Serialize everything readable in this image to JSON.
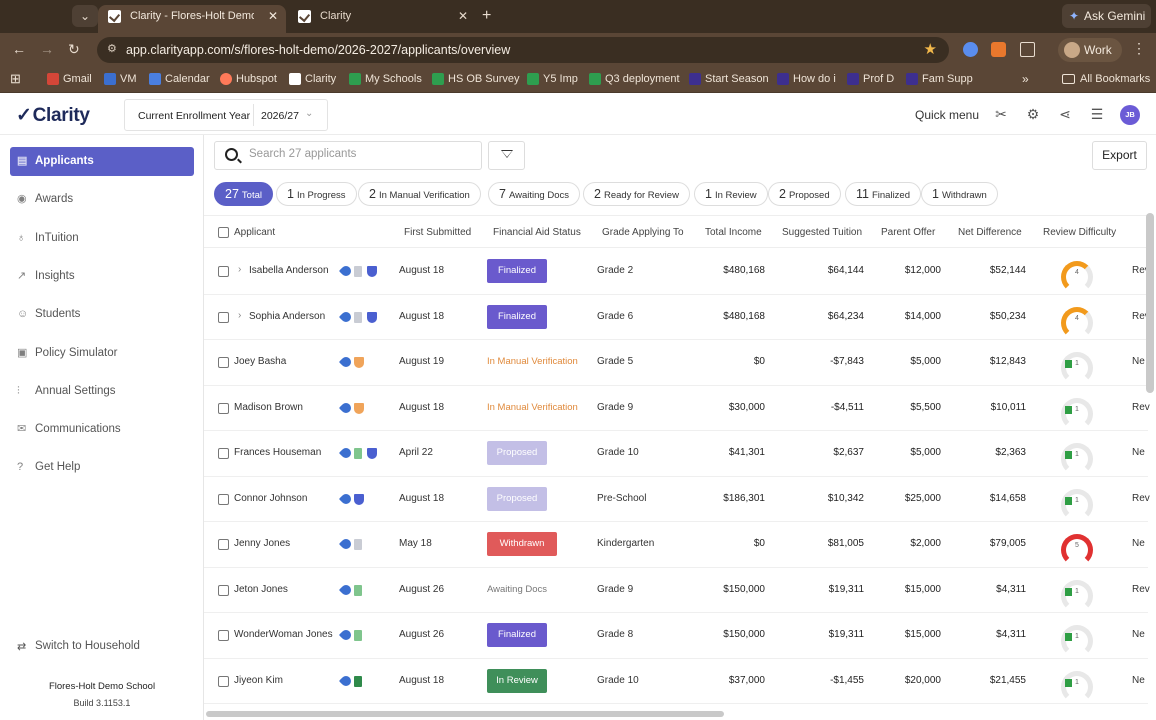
{
  "browser": {
    "tabs": [
      {
        "title": "Clarity - Flores-Holt Demo School",
        "active": true
      },
      {
        "title": "Clarity",
        "active": false
      }
    ],
    "url": "app.clarityapp.com/s/flores-holt-demo/2026-2027/applicants/overview",
    "gemini_label": "Ask Gemini",
    "profile_label": "Work",
    "bookmarks": [
      "Gmail",
      "VM",
      "Calendar",
      "Hubspot",
      "Clarity",
      "My Schools",
      "HS OB Survey",
      "Y5 Imp",
      "Q3 deployment",
      "Start Season",
      "How do i",
      "Prof D",
      "Fam Supp"
    ],
    "all_bookmarks": "All Bookmarks"
  },
  "header": {
    "logo": "Clarity",
    "enroll_label": "Current Enrollment Year",
    "enroll_value": "2026/27",
    "quick_menu": "Quick menu",
    "avatar": "JB"
  },
  "sidebar": {
    "items": [
      {
        "label": "Applicants",
        "icon": "document-icon",
        "active": true
      },
      {
        "label": "Awards",
        "icon": "check-circle-icon",
        "active": false
      },
      {
        "label": "InTuition",
        "icon": "lightbulb-icon",
        "active": false
      },
      {
        "label": "Insights",
        "icon": "trend-icon",
        "active": false
      },
      {
        "label": "Students",
        "icon": "people-icon",
        "active": false
      },
      {
        "label": "Policy Simulator",
        "icon": "policy-icon",
        "active": false
      },
      {
        "label": "Annual Settings",
        "icon": "sliders-icon",
        "active": false
      },
      {
        "label": "Communications",
        "icon": "mail-icon",
        "active": false
      },
      {
        "label": "Get Help",
        "icon": "help-icon",
        "active": false
      }
    ],
    "switch_household": "Switch to Household",
    "school": "Flores-Holt Demo School",
    "build": "Build 3.1153.1"
  },
  "main": {
    "search_placeholder": "Search 27 applicants",
    "export": "Export",
    "chips": [
      {
        "count": "27",
        "label": "Total",
        "active": true
      },
      {
        "count": "1",
        "label": "In Progress",
        "active": false
      },
      {
        "count": "2",
        "label": "In Manual Verification",
        "active": false
      },
      {
        "count": "7",
        "label": "Awaiting Docs",
        "active": false
      },
      {
        "count": "2",
        "label": "Ready for Review",
        "active": false
      },
      {
        "count": "1",
        "label": "In Review",
        "active": false
      },
      {
        "count": "2",
        "label": "Proposed",
        "active": false
      },
      {
        "count": "11",
        "label": "Finalized",
        "active": false
      },
      {
        "count": "1",
        "label": "Withdrawn",
        "active": false
      }
    ],
    "columns": [
      "Applicant",
      "First Submitted",
      "Financial Aid Status",
      "Grade Applying To",
      "Total Income",
      "Suggested Tuition",
      "Parent Offer",
      "Net Difference",
      "Review Difficulty"
    ],
    "rows": [
      {
        "name": "Isabella Anderson",
        "expandable": true,
        "submitted": "August 18",
        "status": "Finalized",
        "status_style": "pill-purple",
        "grade": "Grade 2",
        "income": "$480,168",
        "tuition": "$64,144",
        "offer": "$12,000",
        "net": "$52,144",
        "difficulty": "4",
        "diff_color": "#f29a1c",
        "trail": "Rev",
        "icons": [
          "tag",
          "doc-gray",
          "shield-blue"
        ]
      },
      {
        "name": "Sophia Anderson",
        "expandable": true,
        "submitted": "August 18",
        "status": "Finalized",
        "status_style": "pill-purple",
        "grade": "Grade 6",
        "income": "$480,168",
        "tuition": "$64,234",
        "offer": "$14,000",
        "net": "$50,234",
        "difficulty": "4",
        "diff_color": "#f29a1c",
        "trail": "Rev",
        "icons": [
          "tag",
          "doc-gray",
          "shield-blue"
        ]
      },
      {
        "name": "Joey Basha",
        "expandable": false,
        "submitted": "August 19",
        "status": "In Manual Verification",
        "status_style": "text-orange",
        "grade": "Grade 5",
        "income": "$0",
        "tuition": "-$7,843",
        "offer": "$5,000",
        "net": "$12,843",
        "difficulty": "1",
        "diff_color": "#2f9e44",
        "trail": "Ne",
        "icons": [
          "tag",
          "shield-orange"
        ]
      },
      {
        "name": "Madison Brown",
        "expandable": false,
        "submitted": "August 18",
        "status": "In Manual Verification",
        "status_style": "text-orange",
        "grade": "Grade 9",
        "income": "$30,000",
        "tuition": "-$4,511",
        "offer": "$5,500",
        "net": "$10,011",
        "difficulty": "1",
        "diff_color": "#2f9e44",
        "trail": "Rev",
        "icons": [
          "tag",
          "shield-orange"
        ]
      },
      {
        "name": "Frances Houseman",
        "expandable": false,
        "submitted": "April 22",
        "status": "Proposed",
        "status_style": "pill-lilac",
        "grade": "Grade 10",
        "income": "$41,301",
        "tuition": "$2,637",
        "offer": "$5,000",
        "net": "$2,363",
        "difficulty": "1",
        "diff_color": "#2f9e44",
        "trail": "Ne",
        "icons": [
          "tag",
          "doc-green",
          "shield-blue"
        ]
      },
      {
        "name": "Connor Johnson",
        "expandable": false,
        "submitted": "August 18",
        "status": "Proposed",
        "status_style": "pill-lilac",
        "grade": "Pre-School",
        "income": "$186,301",
        "tuition": "$10,342",
        "offer": "$25,000",
        "net": "$14,658",
        "difficulty": "1",
        "diff_color": "#2f9e44",
        "trail": "Rev",
        "icons": [
          "tag",
          "shield-blue"
        ]
      },
      {
        "name": "Jenny Jones",
        "expandable": false,
        "submitted": "May 18",
        "status": "Withdrawn",
        "status_style": "pill-red",
        "grade": "Kindergarten",
        "income": "$0",
        "tuition": "$81,005",
        "offer": "$2,000",
        "net": "$79,005",
        "difficulty": "5",
        "diff_color": "#e03131",
        "trail": "Ne",
        "icons": [
          "tag",
          "doc-gray"
        ]
      },
      {
        "name": "Jeton Jones",
        "expandable": false,
        "submitted": "August 26",
        "status": "Awaiting Docs",
        "status_style": "text-gray",
        "grade": "Grade 9",
        "income": "$150,000",
        "tuition": "$19,311",
        "offer": "$15,000",
        "net": "$4,311",
        "difficulty": "1",
        "diff_color": "#2f9e44",
        "trail": "Rev",
        "icons": [
          "tag",
          "doc-green"
        ]
      },
      {
        "name": "WonderWoman Jones",
        "expandable": false,
        "submitted": "August 26",
        "status": "Finalized",
        "status_style": "pill-purple",
        "grade": "Grade 8",
        "income": "$150,000",
        "tuition": "$19,311",
        "offer": "$15,000",
        "net": "$4,311",
        "difficulty": "1",
        "diff_color": "#2f9e44",
        "trail": "Ne",
        "icons": [
          "tag",
          "doc-green"
        ]
      },
      {
        "name": "Jiyeon Kim",
        "expandable": false,
        "submitted": "August 18",
        "status": "In Review",
        "status_style": "pill-green",
        "grade": "Grade 10",
        "income": "$37,000",
        "tuition": "-$1,455",
        "offer": "$20,000",
        "net": "$21,455",
        "difficulty": "1",
        "diff_color": "#2f9e44",
        "trail": "Ne",
        "icons": [
          "tag",
          "doc-darkgreen"
        ]
      }
    ]
  },
  "colors": {
    "accent": "#5b5fc7",
    "finalized": "#6a5acd",
    "proposed": "#c3bfe6",
    "withdrawn": "#e05a5a",
    "in_review": "#3f8f5a",
    "manual_verification": "#e08a3c"
  }
}
